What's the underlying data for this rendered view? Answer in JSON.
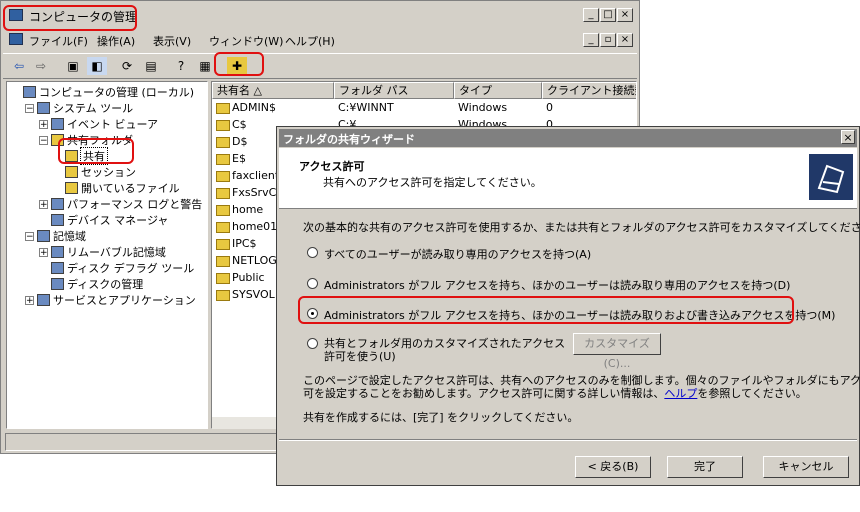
{
  "window": {
    "title": "コンピュータの管理",
    "controls": [
      "_",
      "□",
      "×"
    ],
    "child_controls": [
      "_",
      "▫",
      "×"
    ]
  },
  "menu": [
    "ファイル(F)",
    "操作(A)",
    "表示(V)",
    "ウィンドウ(W)",
    "ヘルプ(H)"
  ],
  "tree": [
    {
      "label": "コンピュータの管理 (ローカル)",
      "depth": 0,
      "expander": ""
    },
    {
      "label": "システム ツール",
      "depth": 1,
      "expander": "−"
    },
    {
      "label": "イベント ビューア",
      "depth": 2,
      "expander": "+"
    },
    {
      "label": "共有フォルダ",
      "depth": 2,
      "expander": "−"
    },
    {
      "label": "共有",
      "depth": 3,
      "expander": ""
    },
    {
      "label": "セッション",
      "depth": 3,
      "expander": ""
    },
    {
      "label": "開いているファイル",
      "depth": 3,
      "expander": ""
    },
    {
      "label": "パフォーマンス ログと警告",
      "depth": 2,
      "expander": "+"
    },
    {
      "label": "デバイス マネージャ",
      "depth": 2,
      "expander": ""
    },
    {
      "label": "記憶域",
      "depth": 1,
      "expander": "−"
    },
    {
      "label": "リムーバブル記憶域",
      "depth": 2,
      "expander": "+"
    },
    {
      "label": "ディスク デフラグ ツール",
      "depth": 2,
      "expander": ""
    },
    {
      "label": "ディスクの管理",
      "depth": 2,
      "expander": ""
    },
    {
      "label": "サービスとアプリケーション",
      "depth": 1,
      "expander": "+"
    }
  ],
  "list": {
    "columns": [
      "共有名 △",
      "フォルダ パス",
      "タイプ",
      "クライアント接続数"
    ],
    "rows": [
      [
        "ADMIN$",
        "C:¥WINNT",
        "Windows",
        "0"
      ],
      [
        "C$",
        "C:¥",
        "Windows",
        "0"
      ],
      [
        "D$",
        "",
        "",
        ""
      ],
      [
        "E$",
        "",
        "",
        ""
      ],
      [
        "faxclient",
        "",
        "",
        ""
      ],
      [
        "FxsSrvC",
        "",
        "",
        ""
      ],
      [
        "home",
        "",
        "",
        ""
      ],
      [
        "home01",
        "",
        "",
        ""
      ],
      [
        "IPC$",
        "",
        "",
        ""
      ],
      [
        "NETLOG",
        "",
        "",
        ""
      ],
      [
        "Public",
        "",
        "",
        ""
      ],
      [
        "SYSVOL",
        "",
        "",
        ""
      ]
    ]
  },
  "wizard": {
    "title": "フォルダの共有ウィザード",
    "close": "×",
    "heading": "アクセス許可",
    "subheading": "共有へのアクセス許可を指定してください。",
    "intro": "次の基本的な共有のアクセス許可を使用するか、または共有とフォルダのアクセス許可をカスタマイズしてください。",
    "options": [
      {
        "label": "すべてのユーザーが読み取り専用のアクセスを持つ(A)",
        "checked": false
      },
      {
        "label": "Administrators がフル アクセスを持ち、ほかのユーザーは読み取り専用のアクセスを持つ(D)",
        "checked": false
      },
      {
        "label": "Administrators がフル アクセスを持ち、ほかのユーザーは読み取りおよび書き込みアクセスを持つ(M)",
        "checked": true
      },
      {
        "label": "共有とフォルダ用のカスタマイズされたアクセス許可を使う(U)",
        "checked": false
      }
    ],
    "customize_button": "カスタマイズ(C)...",
    "note_line1": "このページで設定したアクセス許可は、共有へのアクセスのみを制御します。個々のファイルやフォルダにもアクセス許",
    "note_line2_a": "可を設定することをお勧めします。アクセス許可に関する詳しい情報は、",
    "note_link": "ヘルプ",
    "note_line2_b": "を参照してください。",
    "finish_text": "共有を作成するには、[完了] をクリックしてください。",
    "back_button": "< 戻る(B)",
    "finish_button": "完了",
    "cancel_button": "キャンセル"
  },
  "colors": {
    "highlight": "#e01010",
    "title_inactive": "#808080",
    "folder": "#e8c840",
    "link": "#0000cc"
  }
}
